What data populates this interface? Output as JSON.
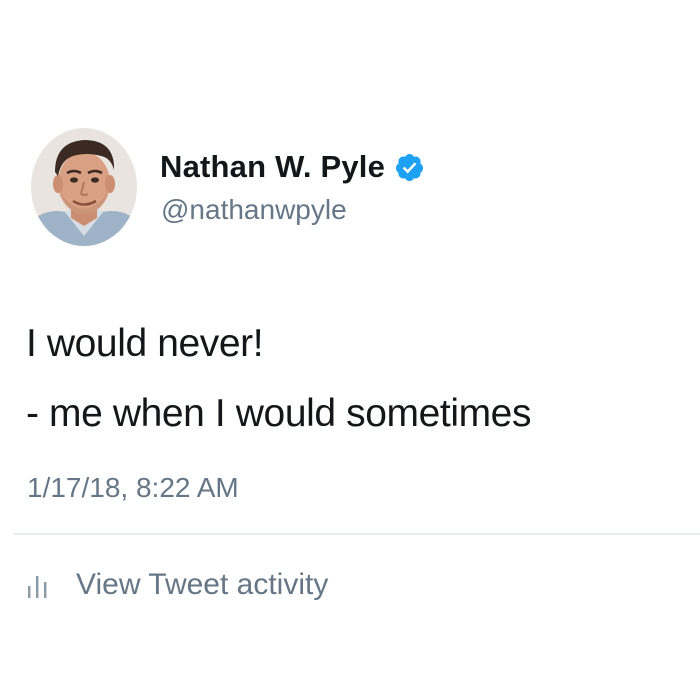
{
  "author": {
    "display_name": "Nathan W. Pyle",
    "handle": "@nathanwpyle",
    "verified": true,
    "avatar_icon": "profile-photo"
  },
  "tweet": {
    "lines": [
      "I would never!",
      "- me when I would sometimes"
    ],
    "timestamp": "1/17/18, 8:22 AM"
  },
  "actions": {
    "activity_label": "View Tweet activity",
    "activity_icon": "bar-chart-icon"
  },
  "colors": {
    "text_primary": "#14171a",
    "text_secondary": "#657786",
    "verified_blue": "#1da1f2",
    "divider": "#e6ecf0"
  }
}
